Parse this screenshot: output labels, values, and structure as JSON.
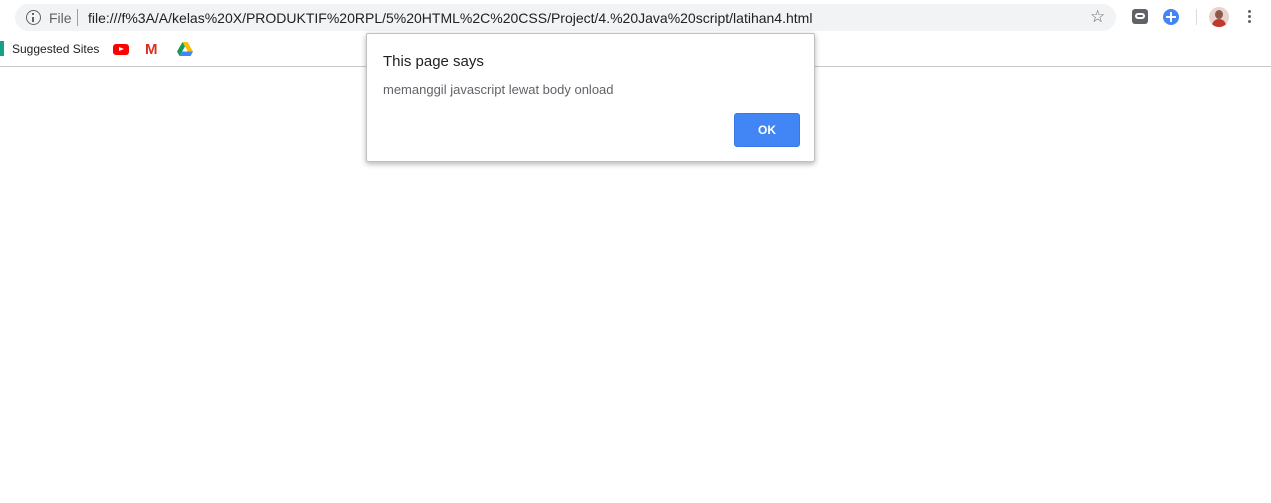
{
  "browser": {
    "address_bar": {
      "scheme_label": "File",
      "url": "file:///f%3A/A/kelas%20X/PRODUKTIF%20RPL/5%20HTML%2C%20CSS/Project/4.%20Java%20script/latihan4.html"
    },
    "bookmarks": [
      {
        "label": "Suggested Sites",
        "icon": "suggested-sites-icon"
      },
      {
        "label": "",
        "icon": "youtube-icon"
      },
      {
        "label": "",
        "icon": "gmail-icon"
      },
      {
        "label": "",
        "icon": "google-drive-icon"
      }
    ],
    "toolbar_icons": [
      "star-icon",
      "extension-chat-icon",
      "extension-plus-icon",
      "profile-avatar",
      "menu-icon"
    ]
  },
  "dialog": {
    "title": "This page says",
    "message": "memanggil javascript lewat body onload",
    "ok_label": "OK"
  },
  "colors": {
    "accent": "#4285f4",
    "omnibox_bg": "#f1f3f4"
  }
}
